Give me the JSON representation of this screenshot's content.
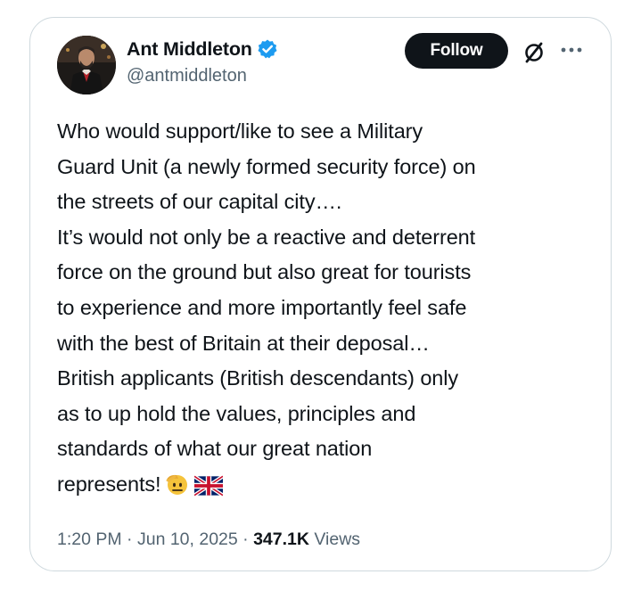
{
  "author": {
    "display_name": "Ant Middleton",
    "handle": "@antmiddleton",
    "verified": true
  },
  "actions": {
    "follow_label": "Follow"
  },
  "tweet": {
    "lines": [
      "Who would support/like to see a Military",
      "Guard Unit (a newly formed security force) on",
      "the streets of our capital city….",
      "It’s would not only be a reactive and deterrent",
      "force on the ground but also great for tourists",
      "to experience and more importantly feel safe",
      "with the best of Britain at their deposal…",
      "British applicants (British descendants) only",
      "as to up hold the values, principles and",
      "standards of what our great nation",
      "represents!"
    ],
    "emojis": [
      "saluting-face-emoji",
      "uk-flag-emoji"
    ]
  },
  "meta": {
    "time": "1:20 PM",
    "separator": " · ",
    "date": "Jun 10, 2025",
    "views_count": "347.1K",
    "views_label": " Views"
  },
  "colors": {
    "text_primary": "#0f1419",
    "text_secondary": "#536471",
    "verified_blue": "#1d9bf0",
    "border": "#cfd9de",
    "follow_bg": "#0f1419"
  }
}
